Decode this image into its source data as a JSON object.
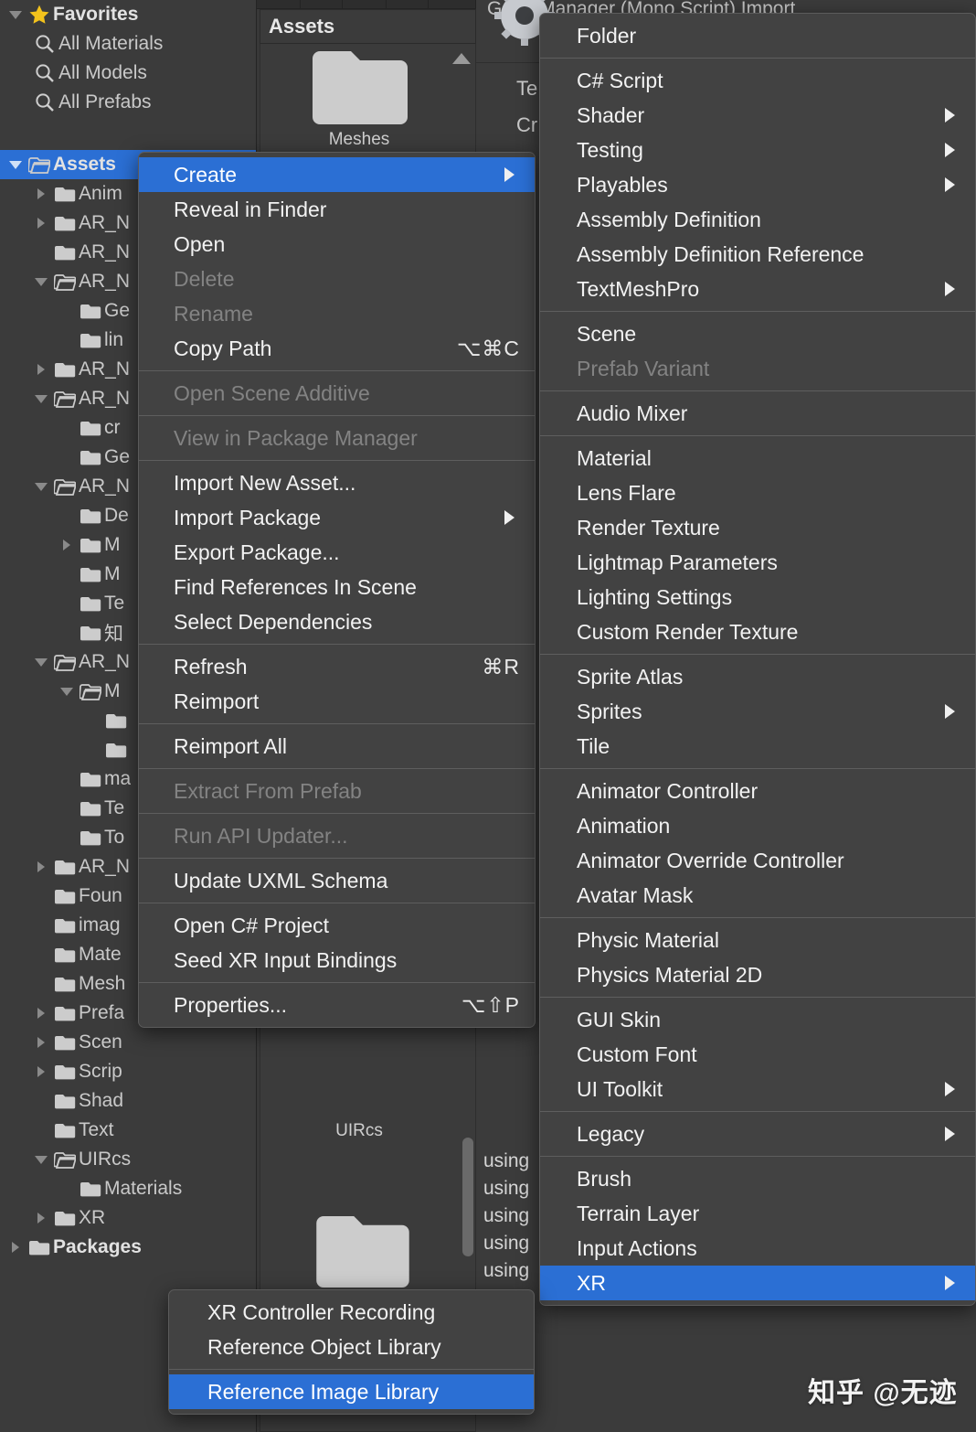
{
  "colors": {
    "highlight_blue": "#2b6fd4",
    "menu_bg": "#424242",
    "panel_bg": "#3b3b3b",
    "editor_bg": "#383838",
    "text": "#f2f2f2",
    "text_disabled": "#838383",
    "folder_icon": "#cccccc",
    "star": "#f2c21c"
  },
  "project_panel": {
    "favorites": {
      "label": "Favorites",
      "icon": "star-icon",
      "expanded": true,
      "items": [
        {
          "label": "All Materials",
          "icon": "search-icon"
        },
        {
          "label": "All Models",
          "icon": "search-icon"
        },
        {
          "label": "All Prefabs",
          "icon": "search-icon"
        }
      ]
    },
    "tree": [
      {
        "label": "Assets",
        "depth": 0,
        "twisty": "open",
        "icon": "folder-open-icon",
        "selected": true,
        "bold": true
      },
      {
        "label": "Anim",
        "depth": 1,
        "twisty": "closed",
        "icon": "folder-icon"
      },
      {
        "label": "AR_N",
        "depth": 1,
        "twisty": "closed",
        "icon": "folder-icon"
      },
      {
        "label": "AR_N",
        "depth": 1,
        "twisty": "none",
        "icon": "folder-icon"
      },
      {
        "label": "AR_N",
        "depth": 1,
        "twisty": "open",
        "icon": "folder-open-icon"
      },
      {
        "label": "Ge",
        "depth": 2,
        "twisty": "none",
        "icon": "folder-icon"
      },
      {
        "label": "lin",
        "depth": 2,
        "twisty": "none",
        "icon": "folder-icon"
      },
      {
        "label": "AR_N",
        "depth": 1,
        "twisty": "closed",
        "icon": "folder-icon"
      },
      {
        "label": "AR_N",
        "depth": 1,
        "twisty": "open",
        "icon": "folder-open-icon"
      },
      {
        "label": "cr",
        "depth": 2,
        "twisty": "none",
        "icon": "folder-icon"
      },
      {
        "label": "Ge",
        "depth": 2,
        "twisty": "none",
        "icon": "folder-icon"
      },
      {
        "label": "AR_N",
        "depth": 1,
        "twisty": "open",
        "icon": "folder-open-icon"
      },
      {
        "label": "De",
        "depth": 2,
        "twisty": "none",
        "icon": "folder-icon"
      },
      {
        "label": "M",
        "depth": 2,
        "twisty": "closed",
        "icon": "folder-icon"
      },
      {
        "label": "M",
        "depth": 2,
        "twisty": "none",
        "icon": "folder-icon"
      },
      {
        "label": "Te",
        "depth": 2,
        "twisty": "none",
        "icon": "folder-icon"
      },
      {
        "label": "知",
        "depth": 2,
        "twisty": "none",
        "icon": "folder-icon"
      },
      {
        "label": "AR_N",
        "depth": 1,
        "twisty": "open",
        "icon": "folder-open-icon"
      },
      {
        "label": "M",
        "depth": 2,
        "twisty": "open",
        "icon": "folder-open-icon"
      },
      {
        "label": "",
        "depth": 3,
        "twisty": "none",
        "icon": "folder-icon"
      },
      {
        "label": "",
        "depth": 3,
        "twisty": "none",
        "icon": "folder-icon"
      },
      {
        "label": "ma",
        "depth": 2,
        "twisty": "none",
        "icon": "folder-icon"
      },
      {
        "label": "Te",
        "depth": 2,
        "twisty": "none",
        "icon": "folder-icon"
      },
      {
        "label": "To",
        "depth": 2,
        "twisty": "none",
        "icon": "folder-icon"
      },
      {
        "label": "AR_N",
        "depth": 1,
        "twisty": "closed",
        "icon": "folder-icon"
      },
      {
        "label": "Foun",
        "depth": 1,
        "twisty": "none",
        "icon": "folder-icon"
      },
      {
        "label": "imag",
        "depth": 1,
        "twisty": "none",
        "icon": "folder-icon"
      },
      {
        "label": "Mate",
        "depth": 1,
        "twisty": "none",
        "icon": "folder-icon"
      },
      {
        "label": "Mesh",
        "depth": 1,
        "twisty": "none",
        "icon": "folder-icon"
      },
      {
        "label": "Prefa",
        "depth": 1,
        "twisty": "closed",
        "icon": "folder-icon"
      },
      {
        "label": "Scen",
        "depth": 1,
        "twisty": "closed",
        "icon": "folder-icon"
      },
      {
        "label": "Scrip",
        "depth": 1,
        "twisty": "closed",
        "icon": "folder-icon"
      },
      {
        "label": "Shad",
        "depth": 1,
        "twisty": "none",
        "icon": "folder-icon"
      },
      {
        "label": "Text",
        "depth": 1,
        "twisty": "none",
        "icon": "folder-icon"
      },
      {
        "label": "UIRcs",
        "depth": 1,
        "twisty": "open",
        "icon": "folder-open-icon"
      },
      {
        "label": "Materials",
        "depth": 2,
        "twisty": "none",
        "icon": "folder-icon"
      },
      {
        "label": "XR",
        "depth": 1,
        "twisty": "closed",
        "icon": "folder-icon"
      },
      {
        "label": "Packages",
        "depth": 0,
        "twisty": "closed",
        "icon": "folder-icon",
        "bold": true
      }
    ]
  },
  "assets_pane": {
    "header": "Assets",
    "items": [
      {
        "caption": "Meshes",
        "icon": "folder-thumbnail"
      },
      {
        "caption": "UIRcs",
        "icon": "folder-thumbnail"
      }
    ],
    "scroll_up_arrow": "scroll-up-arrow"
  },
  "inspector": {
    "title": "GameManager (Mono Script)  Import",
    "gear_icon": "gear-icon",
    "lines": [
      "Te",
      "Cr"
    ],
    "code_lines": [
      "using",
      "using",
      "using",
      "using",
      "using"
    ]
  },
  "context_menu": {
    "name": "asset-context-menu",
    "items": [
      {
        "label": "Create",
        "submenu": true,
        "highlighted": true
      },
      {
        "label": "Reveal in Finder"
      },
      {
        "label": "Open"
      },
      {
        "label": "Delete",
        "disabled": true
      },
      {
        "label": "Rename",
        "disabled": true
      },
      {
        "label": "Copy Path",
        "shortcut": "⌥⌘C"
      },
      {
        "separator": true
      },
      {
        "label": "Open Scene Additive",
        "disabled": true
      },
      {
        "separator": true
      },
      {
        "label": "View in Package Manager",
        "disabled": true
      },
      {
        "separator": true
      },
      {
        "label": "Import New Asset..."
      },
      {
        "label": "Import Package",
        "submenu": true
      },
      {
        "label": "Export Package..."
      },
      {
        "label": "Find References In Scene"
      },
      {
        "label": "Select Dependencies"
      },
      {
        "separator": true
      },
      {
        "label": "Refresh",
        "shortcut": "⌘R"
      },
      {
        "label": "Reimport"
      },
      {
        "separator": true
      },
      {
        "label": "Reimport All"
      },
      {
        "separator": true
      },
      {
        "label": "Extract From Prefab",
        "disabled": true
      },
      {
        "separator": true
      },
      {
        "label": "Run API Updater...",
        "disabled": true
      },
      {
        "separator": true
      },
      {
        "label": "Update UXML Schema"
      },
      {
        "separator": true
      },
      {
        "label": "Open C# Project"
      },
      {
        "label": "Seed XR Input Bindings"
      },
      {
        "separator": true
      },
      {
        "label": "Properties...",
        "shortcut": "⌥⇧P"
      }
    ]
  },
  "create_submenu": {
    "name": "create-submenu",
    "items": [
      {
        "label": "Folder"
      },
      {
        "separator": true
      },
      {
        "label": "C# Script"
      },
      {
        "label": "Shader",
        "submenu": true
      },
      {
        "label": "Testing",
        "submenu": true
      },
      {
        "label": "Playables",
        "submenu": true
      },
      {
        "label": "Assembly Definition"
      },
      {
        "label": "Assembly Definition Reference"
      },
      {
        "label": "TextMeshPro",
        "submenu": true
      },
      {
        "separator": true
      },
      {
        "label": "Scene"
      },
      {
        "label": "Prefab Variant",
        "disabled": true
      },
      {
        "separator": true
      },
      {
        "label": "Audio Mixer"
      },
      {
        "separator": true
      },
      {
        "label": "Material"
      },
      {
        "label": "Lens Flare"
      },
      {
        "label": "Render Texture"
      },
      {
        "label": "Lightmap Parameters"
      },
      {
        "label": "Lighting Settings"
      },
      {
        "label": "Custom Render Texture"
      },
      {
        "separator": true
      },
      {
        "label": "Sprite Atlas"
      },
      {
        "label": "Sprites",
        "submenu": true
      },
      {
        "label": "Tile"
      },
      {
        "separator": true
      },
      {
        "label": "Animator Controller"
      },
      {
        "label": "Animation"
      },
      {
        "label": "Animator Override Controller"
      },
      {
        "label": "Avatar Mask"
      },
      {
        "separator": true
      },
      {
        "label": "Physic Material"
      },
      {
        "label": "Physics Material 2D"
      },
      {
        "separator": true
      },
      {
        "label": "GUI Skin"
      },
      {
        "label": "Custom Font"
      },
      {
        "label": "UI Toolkit",
        "submenu": true
      },
      {
        "separator": true
      },
      {
        "label": "Legacy",
        "submenu": true
      },
      {
        "separator": true
      },
      {
        "label": "Brush"
      },
      {
        "label": "Terrain Layer"
      },
      {
        "label": "Input Actions"
      },
      {
        "label": "XR",
        "submenu": true,
        "highlighted": true
      }
    ]
  },
  "xr_submenu": {
    "name": "xr-submenu",
    "items": [
      {
        "label": "XR Controller Recording"
      },
      {
        "label": "Reference Object Library"
      },
      {
        "separator": true
      },
      {
        "label": "Reference Image Library",
        "highlighted": true
      }
    ]
  },
  "watermark": "知乎 @无迹"
}
